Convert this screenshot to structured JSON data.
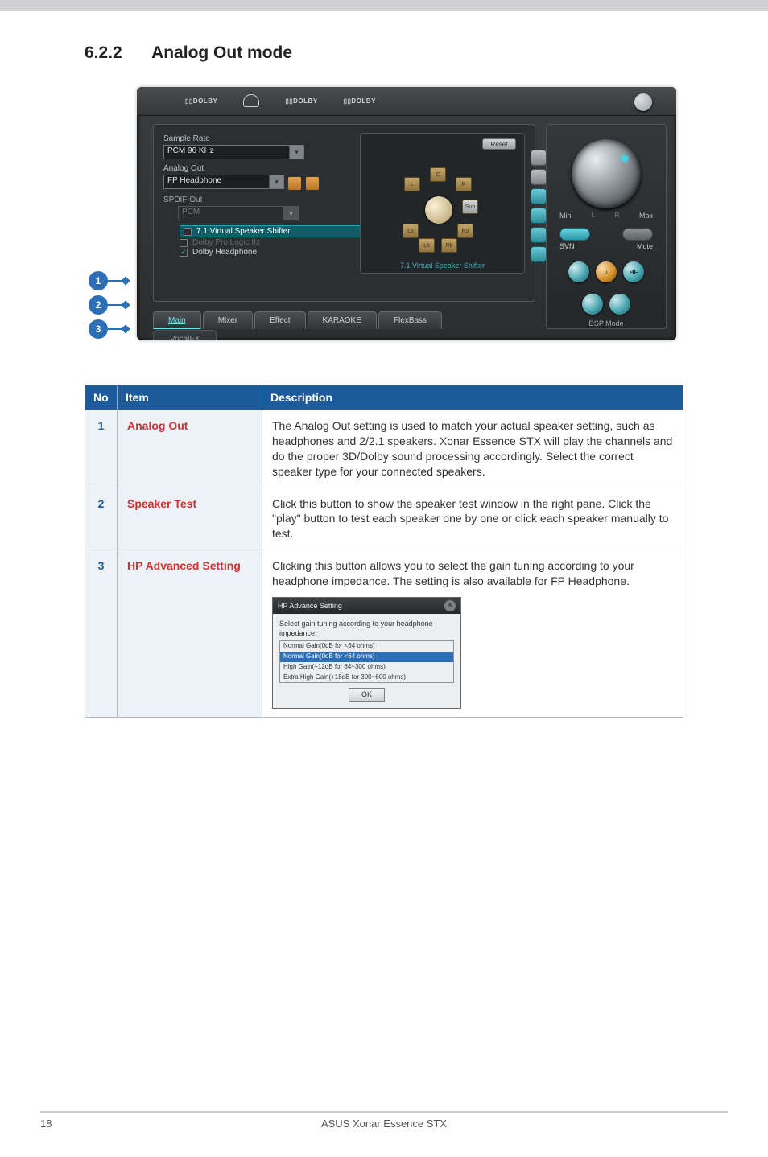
{
  "section": {
    "number": "6.2.2",
    "title": "Analog Out mode"
  },
  "callouts": [
    "1",
    "2",
    "3"
  ],
  "shot": {
    "dolby": [
      "▯▯DOLBY",
      "▯▯DOLBY",
      "▯▯DOLBY"
    ],
    "sampleRateLabel": "Sample Rate",
    "sampleRateValue": "PCM 96 KHz",
    "analogOutLabel": "Analog Out",
    "analogOutValue": "FP Headphone",
    "spdifLabel": "SPDIF Out",
    "spdifValue": "PCM",
    "opts": {
      "virtualSpeaker": "7.1 Virtual Speaker Shifter",
      "prologic": "Dolby Pro Logic IIx",
      "headphone": "Dolby Headphone"
    },
    "speakerPanel": {
      "reset": "Reset",
      "caption": "7.1 Virtual Speaker Shifter",
      "labels": {
        "c": "C",
        "l": "L",
        "r": "R",
        "sub": "Sub",
        "ls": "Ls",
        "rs": "Rs",
        "lb": "Lb",
        "rb": "Rb"
      }
    },
    "tabs": [
      "Main",
      "Mixer",
      "Effect",
      "KARAOKE",
      "FlexBass"
    ],
    "tab2": "VocalFX",
    "right": {
      "min": "Min",
      "max": "Max",
      "l": "L",
      "r": "R",
      "svn": "SVN",
      "mute": "Mute",
      "hf": "HF",
      "dsp": "DSP Mode"
    }
  },
  "table": {
    "headers": {
      "no": "No",
      "item": "Item",
      "desc": "Description"
    },
    "rows": [
      {
        "no": "1",
        "item": "Analog Out",
        "desc": "The Analog Out setting is used to match your actual speaker setting, such as headphones and 2/2.1 speakers. Xonar Essence STX will play the channels and do the proper 3D/Dolby sound processing accordingly. Select the correct speaker type for your connected speakers."
      },
      {
        "no": "2",
        "item": "Speaker Test",
        "desc": "Click this button to show the speaker test window in the right pane. Click the \"play\" button to test each speaker one by one or click each speaker manually to test."
      },
      {
        "no": "3",
        "item": "HP Advanced Setting",
        "desc": "Clicking this button allows you to select the gain tuning according to your headphone impedance. The setting is also available for FP Headphone."
      }
    ]
  },
  "hpDialog": {
    "title": "HP Advance Setting",
    "text": "Select gain tuning according to your headphone impedance.",
    "options": [
      "Normal Gain(0dB for <64 ohms)",
      "Normal Gain(0dB for <64 ohms)",
      "High Gain(+12dB for 64~300 ohms)",
      "Extra High Gain(+18dB for 300~600 ohms)"
    ],
    "ok": "OK"
  },
  "footer": {
    "page": "18",
    "title": "ASUS Xonar Essence STX"
  }
}
